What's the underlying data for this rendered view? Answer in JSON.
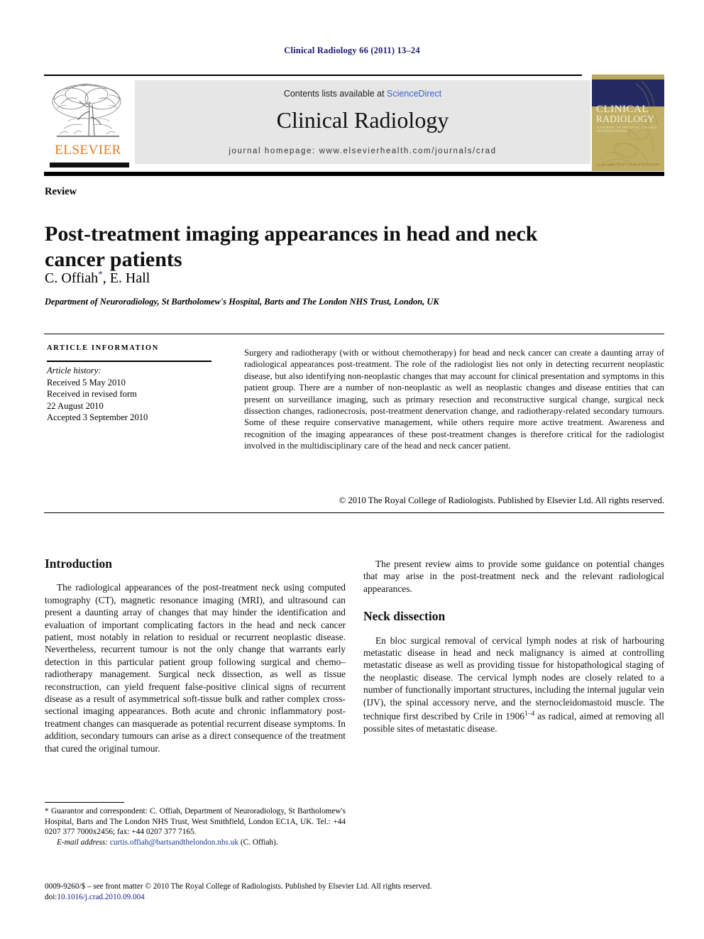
{
  "running_head": "Clinical Radiology 66 (2011) 13–24",
  "masthead": {
    "contents_prefix": "Contents lists available at ",
    "contents_link": "ScienceDirect",
    "journal_name": "Clinical Radiology",
    "homepage": "journal homepage: www.elsevierhealth.com/journals/crad",
    "publisher_name": "ELSEVIER",
    "cover": {
      "line1": "CLINICAL",
      "line2": "RADIOLOGY",
      "subtitle": "A JOURNAL OF THE ROYAL COLLEGE OF RADIOLOGISTS",
      "foot_left": "ELSEVIER",
      "foot_right": "The Royal College of Radiologists"
    }
  },
  "article": {
    "type": "Review",
    "title": "Post-treatment imaging appearances in head and neck cancer patients",
    "authors": "C. Offiah, E. Hall",
    "author_marker": "*",
    "affiliation": "Department of Neuroradiology, St Bartholomew's Hospital, Barts and The London NHS Trust, London, UK"
  },
  "article_information": {
    "heading": "ARTICLE INFORMATION",
    "history_label": "Article history:",
    "received": "Received 5 May 2010",
    "revised_label": "Received in revised form",
    "revised_date": "22 August 2010",
    "accepted": "Accepted 3 September 2010"
  },
  "abstract": {
    "text": "Surgery and radiotherapy (with or without chemotherapy) for head and neck cancer can create a daunting array of radiological appearances post-treatment. The role of the radiologist lies not only in detecting recurrent neoplastic disease, but also identifying non-neoplastic changes that may account for clinical presentation and symptoms in this patient group. There are a number of non-neoplastic as well as neoplastic changes and disease entities that can present on surveillance imaging, such as primary resection and reconstructive surgical change, surgical neck dissection changes, radionecrosis, post-treatment denervation change, and radiotherapy-related secondary tumours. Some of these require conservative management, while others require more active treatment. Awareness and recognition of the imaging appearances of these post-treatment changes is therefore critical for the radiologist involved in the multidisciplinary care of the head and neck cancer patient.",
    "copyright": "© 2010 The Royal College of Radiologists. Published by Elsevier Ltd. All rights reserved."
  },
  "body": {
    "introduction_heading": "Introduction",
    "intro_p1": "The radiological appearances of the post-treatment neck using computed tomography (CT), magnetic resonance imaging (MRI), and ultrasound can present a daunting array of changes that may hinder the identification and evaluation of important complicating factors in the head and neck cancer patient, most notably in relation to residual or recurrent neoplastic disease. Nevertheless, recurrent tumour is not the only change that warrants early detection in this particular patient group following surgical and chemo–radiotherapy management. Surgical neck dissection, as well as tissue reconstruction, can yield frequent false-positive clinical signs of recurrent disease as a result of asymmetrical soft-tissue bulk and rather complex cross-sectional imaging appearances. Both acute and chronic inflammatory post-treatment changes can masquerade as potential recurrent disease symptoms. In addition, secondary tumours can arise as a direct consequence of the treatment that cured the original tumour.",
    "intro_p2": "The present review aims to provide some guidance on potential changes that may arise in the post-treatment neck and the relevant radiological appearances.",
    "neck_heading": "Neck dissection",
    "neck_p1_before_ref": "En bloc surgical removal of cervical lymph nodes at risk of harbouring metastatic disease in head and neck malignancy is aimed at controlling metastatic disease as well as providing tissue for histopathological staging of the neoplastic disease. The cervical lymph nodes are closely related to a number of functionally important structures, including the internal jugular vein (IJV), the spinal accessory nerve, and the sternocleidomastoid muscle. The technique first described by Crile in 1906",
    "neck_p1_ref": "1–4",
    "neck_p1_after_ref": " as radical, aimed at removing all possible sites of metastatic disease."
  },
  "footnote": {
    "correspondence": "* Guarantor and correspondent: C. Offiah, Department of Neuroradiology, St Bartholomew's Hospital, Barts and The London NHS Trust, West Smithfield, London EC1A, UK. Tel.: +44 0207 377 7000x2456; fax: +44 0207 377 7165.",
    "email_label": "E-mail address:",
    "email": "curtis.offiah@bartsandthelondon.nhs.uk",
    "email_suffix": "(C. Offiah)."
  },
  "colophon": {
    "line1": "0009-9260/$ – see front matter © 2010 The Royal College of Radiologists. Published by Elsevier Ltd. All rights reserved.",
    "doi_label": "doi:",
    "doi": "10.1016/j.crad.2010.09.004"
  },
  "colors": {
    "running_head": "#1a1a6e",
    "link": "#3a5fcd",
    "elsevier_orange": "#e87722",
    "cover_navy": "#232a62",
    "cover_khaki": "#bfae63",
    "band_grey": "#e6e6e6"
  }
}
